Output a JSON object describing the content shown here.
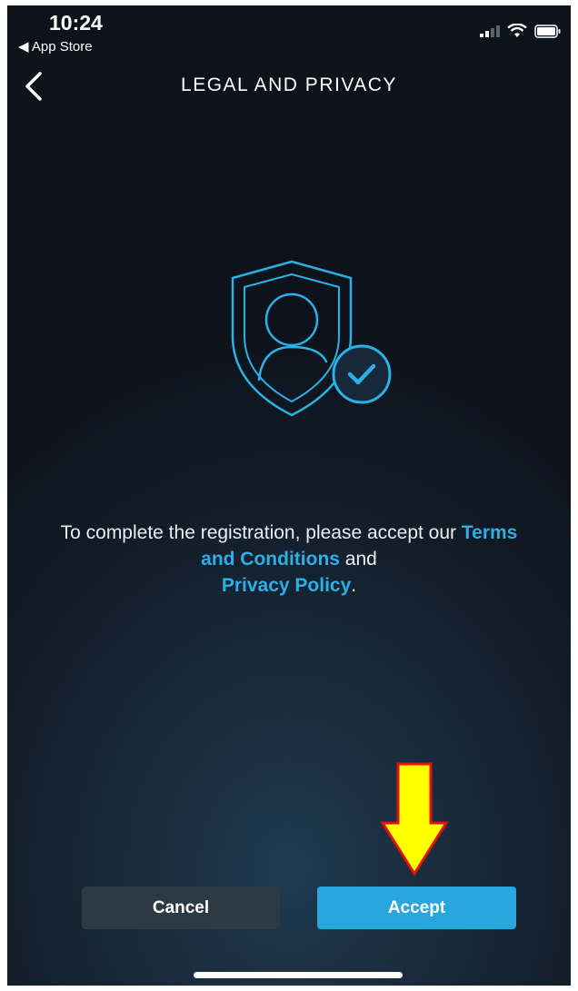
{
  "status_bar": {
    "time": "10:24",
    "back_to_app": "◀ App Store"
  },
  "header": {
    "title": "LEGAL AND PRIVACY"
  },
  "message": {
    "line1": "To complete the registration, please accept our ",
    "terms_link": "Terms and Conditions",
    "conjunction": " and ",
    "privacy_link": "Privacy Policy",
    "end": "."
  },
  "buttons": {
    "cancel_label": "Cancel",
    "accept_label": "Accept"
  },
  "colors": {
    "accent": "#2aa6df",
    "link": "#2bb0e6",
    "annotation_arrow": "#ffff00"
  },
  "icons": {
    "status": [
      "cellular-signal-icon",
      "wifi-icon",
      "battery-icon"
    ],
    "illustration": "shield-user-check-icon",
    "annotation": "arrow-down-icon"
  }
}
